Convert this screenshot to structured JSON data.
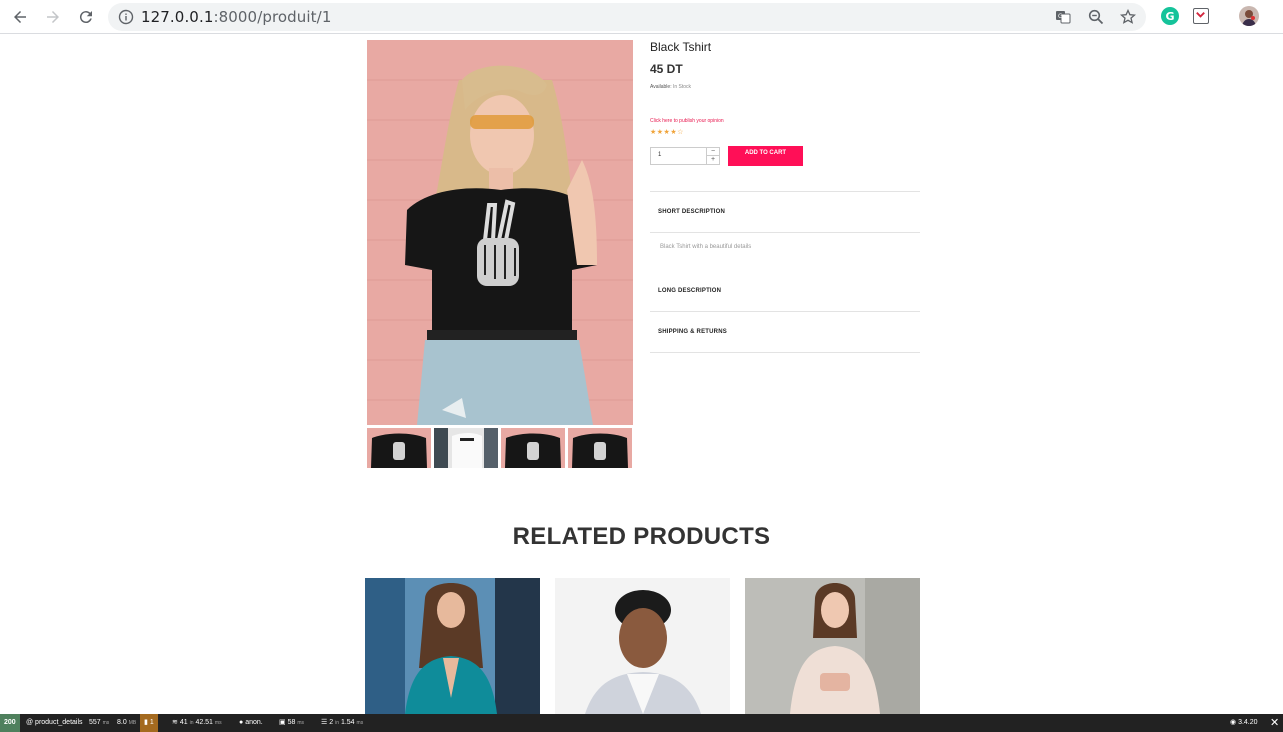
{
  "browser": {
    "url_host": "127.0.0.1",
    "url_path": ":8000/produit/1"
  },
  "product": {
    "name": "Black Tshirt",
    "price": "45 DT",
    "availability_label": "Available:",
    "availability_value": "In Stock",
    "opinion_link": "Click here to publish your opinion",
    "rating_stars": "★★★★☆",
    "quantity": "1",
    "qty_minus": "−",
    "qty_plus": "+",
    "add_to_cart": "ADD TO CART"
  },
  "accordion": {
    "short_title": "SHORT DESCRIPTION",
    "short_body": "Black Tshirt with a beautiful details",
    "long_title": "LONG DESCRIPTION",
    "shipping_title": "SHIPPING & RETURNS"
  },
  "related": {
    "title": "RELATED PRODUCTS"
  },
  "debug_toolbar": {
    "status": "200",
    "route": "@ product_details",
    "time_value": "557",
    "time_unit": "ms",
    "memory_value": "8.0",
    "memory_unit": "MB",
    "warnings": "1",
    "queries_value": "41",
    "queries_in": "in",
    "queries_time": "42.51",
    "queries_unit": "ms",
    "user": "anon.",
    "twig_value": "58",
    "twig_unit": "ms",
    "cache_value": "2",
    "cache_in": "in",
    "cache_time": "1.54",
    "cache_unit": "ms",
    "version": "3.4.20"
  }
}
